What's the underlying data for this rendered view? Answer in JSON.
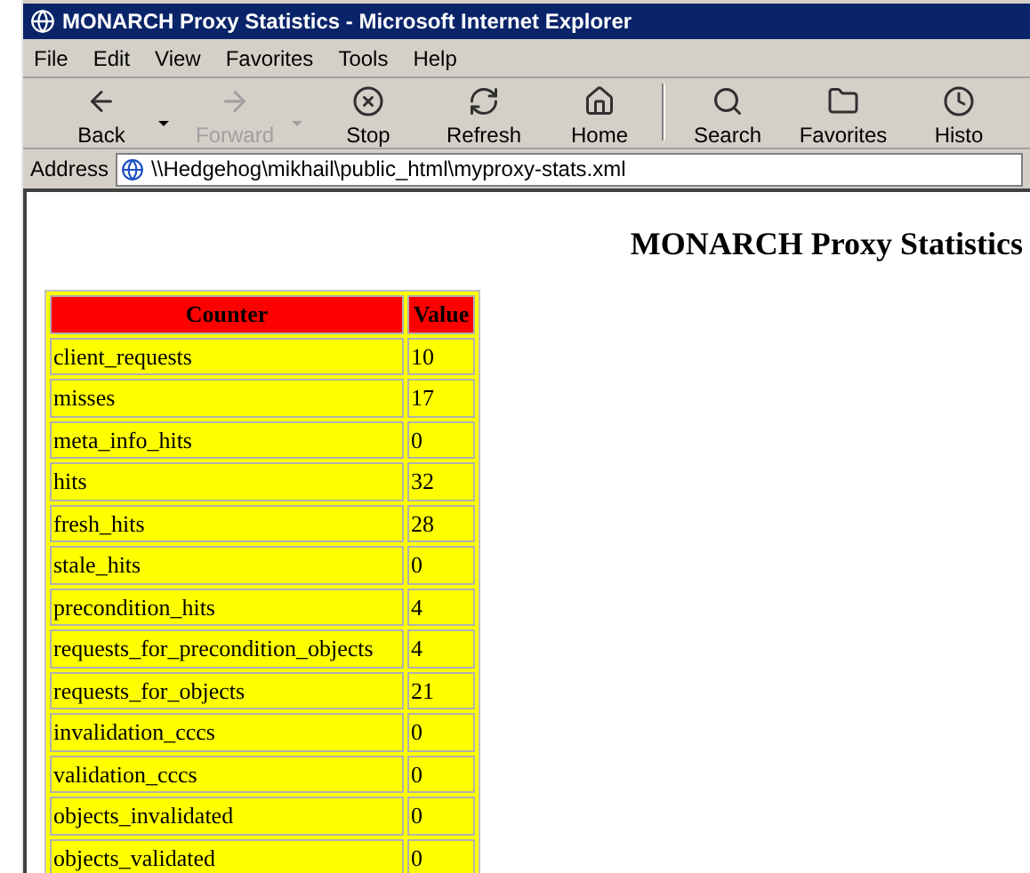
{
  "window": {
    "title": "MONARCH Proxy Statistics - Microsoft Internet Explorer"
  },
  "menu": [
    "File",
    "Edit",
    "View",
    "Favorites",
    "Tools",
    "Help"
  ],
  "toolbar": [
    {
      "kind": "back",
      "label": "Back",
      "disabled": false,
      "dropdown": true
    },
    {
      "kind": "forward",
      "label": "Forward",
      "disabled": true,
      "dropdown": true
    },
    {
      "kind": "stop",
      "label": "Stop",
      "disabled": false,
      "dropdown": false
    },
    {
      "kind": "refresh",
      "label": "Refresh",
      "disabled": false,
      "dropdown": false
    },
    {
      "kind": "home",
      "label": "Home",
      "disabled": false,
      "dropdown": false
    },
    {
      "kind": "separator"
    },
    {
      "kind": "search",
      "label": "Search",
      "disabled": false,
      "dropdown": false
    },
    {
      "kind": "favorites",
      "label": "Favorites",
      "disabled": false,
      "dropdown": false
    },
    {
      "kind": "history",
      "label": "Histo",
      "disabled": false,
      "dropdown": false
    }
  ],
  "address": {
    "label": "Address",
    "value": "\\\\Hedgehog\\mikhail\\public_html\\myproxy-stats.xml"
  },
  "page": {
    "heading": "MONARCH Proxy Statistics",
    "table": {
      "columns": [
        "Counter",
        "Value"
      ],
      "rows": [
        [
          "client_requests",
          "10"
        ],
        [
          "misses",
          "17"
        ],
        [
          "meta_info_hits",
          "0"
        ],
        [
          "hits",
          "32"
        ],
        [
          "fresh_hits",
          "28"
        ],
        [
          "stale_hits",
          "0"
        ],
        [
          "precondition_hits",
          "4"
        ],
        [
          "requests_for_precondition_objects",
          "4"
        ],
        [
          "requests_for_objects",
          "21"
        ],
        [
          "invalidation_cccs",
          "0"
        ],
        [
          "validation_cccs",
          "0"
        ],
        [
          "objects_invalidated",
          "0"
        ],
        [
          "objects_validated",
          "0"
        ]
      ]
    }
  }
}
